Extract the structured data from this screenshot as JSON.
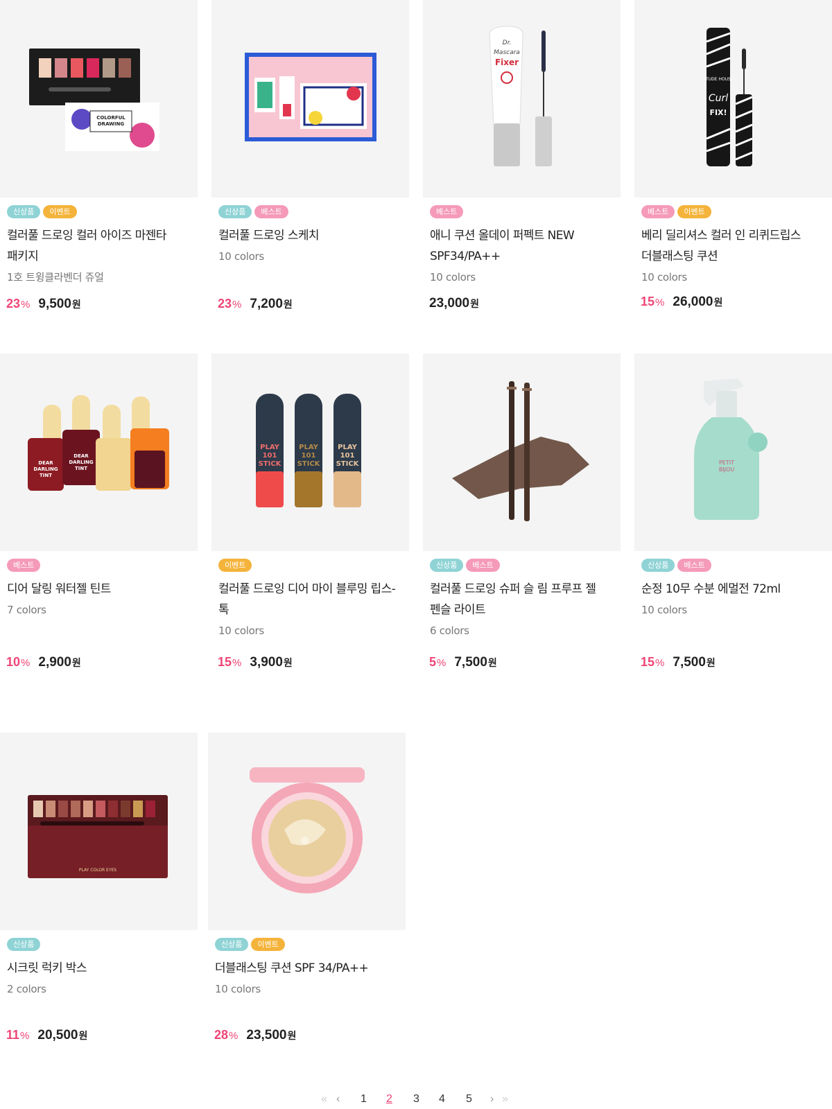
{
  "badge_labels": {
    "new": "신상품",
    "event": "이벤트",
    "best": "베스트"
  },
  "currency": "원",
  "percent": "%",
  "products": [
    {
      "name": "컬러풀 드로잉 컬러 아이즈 마젠타 패키지",
      "sub": "1호 트윙클라벤더 쥬얼",
      "discount": "23",
      "price": "9,500"
    },
    {
      "name": "컬러풀 드로잉 스케치",
      "sub": "10 colors",
      "discount": "23",
      "price": "7,200"
    },
    {
      "name": "애니 쿠션 올데이  퍼펙트 NEW SPF34/PA++",
      "sub": "10 colors",
      "discount": "",
      "price": "23,000"
    },
    {
      "name": "베리 딜리셔스 컬러 인 리퀴드립스 더블래스팅 쿠션",
      "sub": "10 colors",
      "discount": "15",
      "price": "26,000"
    },
    {
      "name": "디어 달링 워터젤 틴트",
      "sub": "7 colors",
      "discount": "10",
      "price": "2,900"
    },
    {
      "name": "컬러풀 드로잉 디어  마이 블루밍 립스-톡",
      "sub": "10 colors",
      "discount": "15",
      "price": "3,900"
    },
    {
      "name": "컬러풀 드로잉 슈퍼 슬 림 프루프 젤 펜슬 라이트",
      "sub": "6 colors",
      "discount": "5",
      "price": "7,500"
    },
    {
      "name": "순정 10무 수분 에멀전 72ml",
      "sub": "10 colors",
      "discount": "15",
      "price": "7,500"
    },
    {
      "name": "시크릿 럭키 박스",
      "sub": "2 colors",
      "discount": "11",
      "price": "20,500"
    },
    {
      "name": "더블래스팅 쿠션 SPF 34/PA++",
      "sub": "10 colors",
      "discount": "28",
      "price": "23,500"
    }
  ],
  "product_images": [
    "Colorful Drawing eyeshadow palette with pink and magenta shades",
    "Colorful Drawing sketch kit in blue box",
    "Dr. Mascara Fixer tube and wand",
    "Curl Fix mascara with zebra pattern",
    "Dear Darling popsicle-shaped tints",
    "Play 101 Stick trio",
    "Drawing eye brow pencils with swatch",
    "Petit Bijou mint spray bottle",
    "Play Color Eyes wine palette",
    "Pink cushion compact"
  ],
  "image_labels": {
    "p0": [
      "COLORFUL",
      "DRAWING"
    ],
    "p2": [
      "Dr.",
      "Mascara",
      "Fixer"
    ],
    "p3": [
      "ETUDE HOUSE",
      "Curl",
      "FIX!"
    ],
    "p4": [
      "DEAR",
      "DARLING",
      "TINT"
    ],
    "p5": [
      "PLAY",
      "101",
      "STICK"
    ],
    "p7": [
      "PETIT",
      "BIJOU"
    ],
    "p8": [
      "PLAY COLOR EYES"
    ]
  },
  "pagination": {
    "first": "«",
    "prev": "‹",
    "pages": [
      "1",
      "2",
      "3",
      "4",
      "5"
    ],
    "current": "2",
    "next": "›",
    "last": "»"
  },
  "colors": {
    "accent": "#ef4476",
    "badge_new": "#8fd3d5",
    "badge_event": "#f4b33a",
    "badge_best": "#f59ab9",
    "image_bg": "#f4f4f4"
  }
}
